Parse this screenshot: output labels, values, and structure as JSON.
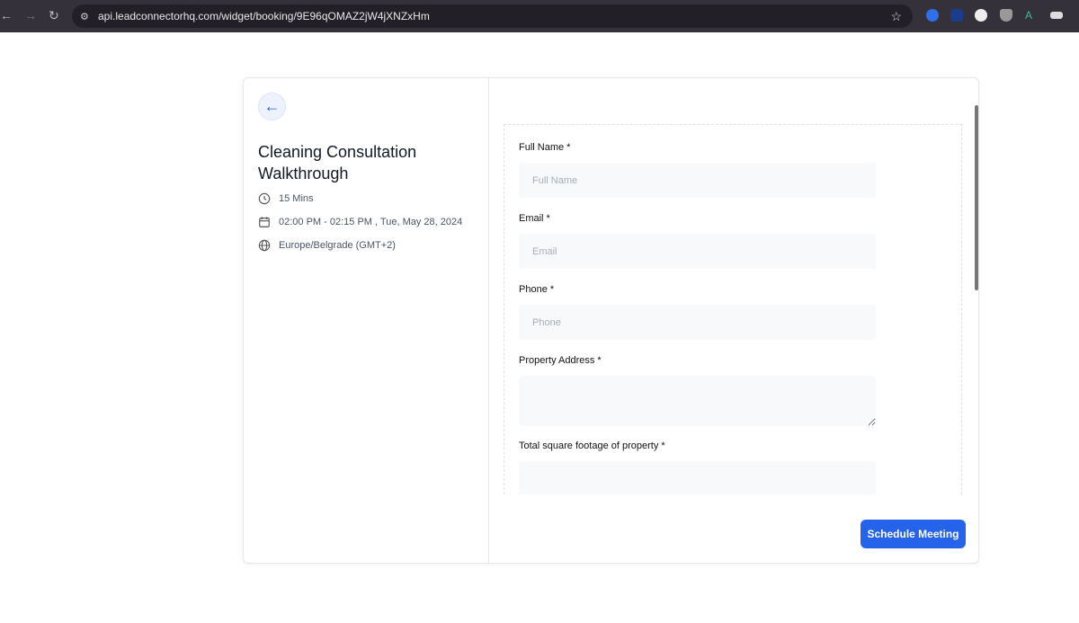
{
  "browser": {
    "url": "api.leadconnectorhq.com/widget/booking/9E96qOMAZ2jW4jXNZxHm"
  },
  "event": {
    "title": "Cleaning Consultation Walkthrough",
    "duration": "15 Mins",
    "datetime": "02:00 PM - 02:15 PM , Tue, May 28, 2024",
    "timezone": "Europe/Belgrade (GMT+2)"
  },
  "form": {
    "fields": [
      {
        "label": "Full Name *",
        "placeholder": "Full Name"
      },
      {
        "label": "Email *",
        "placeholder": "Email"
      },
      {
        "label": "Phone *",
        "placeholder": "Phone"
      },
      {
        "label": "Property Address *",
        "placeholder": ""
      },
      {
        "label": "Total square footage of property *",
        "placeholder": ""
      }
    ],
    "submit": "Schedule Meeting"
  }
}
